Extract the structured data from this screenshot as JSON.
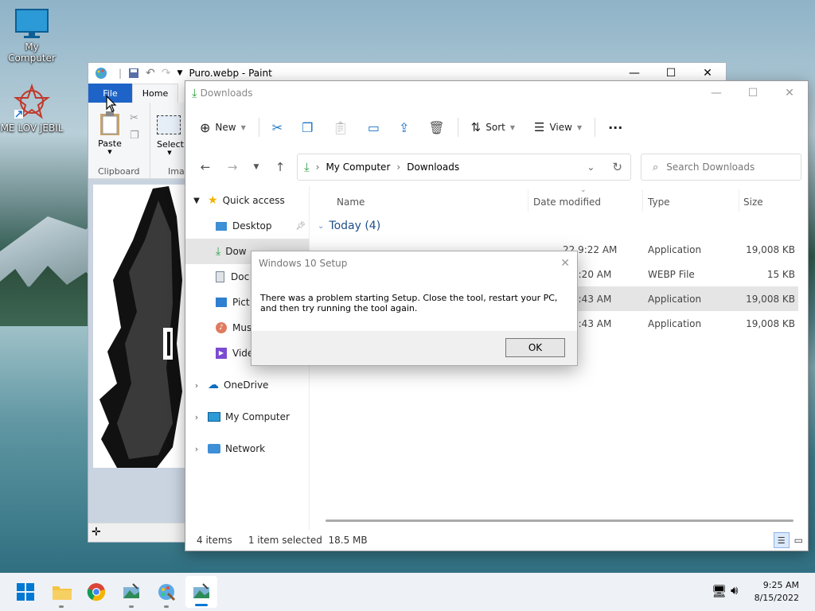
{
  "desktop": {
    "icons": [
      {
        "label": "My Computer"
      },
      {
        "label": "ME LOV JEBIL"
      }
    ]
  },
  "paint": {
    "title": "Puro.webp - Paint",
    "tabs": {
      "file": "File",
      "home": "Home"
    },
    "groups": {
      "clipboard": "Clipboard",
      "image": "Imag"
    },
    "buttons": {
      "paste": "Paste",
      "select": "Select"
    }
  },
  "explorer": {
    "title": "Downloads",
    "toolbar": {
      "new": "New",
      "sort": "Sort",
      "view": "View"
    },
    "breadcrumb": [
      "My Computer",
      "Downloads"
    ],
    "search_placeholder": "Search Downloads",
    "sidebar": [
      {
        "label": "Quick access"
      },
      {
        "label": "Desktop"
      },
      {
        "label": "Dow"
      },
      {
        "label": "Doc"
      },
      {
        "label": "Pict"
      },
      {
        "label": "Musi"
      },
      {
        "label": "Videos"
      },
      {
        "label": "OneDrive"
      },
      {
        "label": "My Computer"
      },
      {
        "label": "Network"
      }
    ],
    "columns": {
      "name": "Name",
      "date": "Date modified",
      "type": "Type",
      "size": "Size"
    },
    "group_label": "Today (4)",
    "rows": [
      {
        "date": "22 9:22 AM",
        "type": "Application",
        "size": "19,008 KB"
      },
      {
        "date": "9:20 AM",
        "type": "WEBP File",
        "size": "15 KB"
      },
      {
        "date": "8:43 AM",
        "type": "Application",
        "size": "19,008 KB"
      },
      {
        "date": "8:43 AM",
        "type": "Application",
        "size": "19,008 KB"
      }
    ],
    "status": {
      "items": "4 items",
      "selected": "1 item selected",
      "size": "18.5 MB"
    }
  },
  "dialog": {
    "title": "Windows 10 Setup",
    "message": "There was a problem starting Setup. Close the tool, restart your PC, and then try running the tool again.",
    "ok": "OK"
  },
  "tray": {
    "time": "9:25 AM",
    "date": "8/15/2022"
  }
}
